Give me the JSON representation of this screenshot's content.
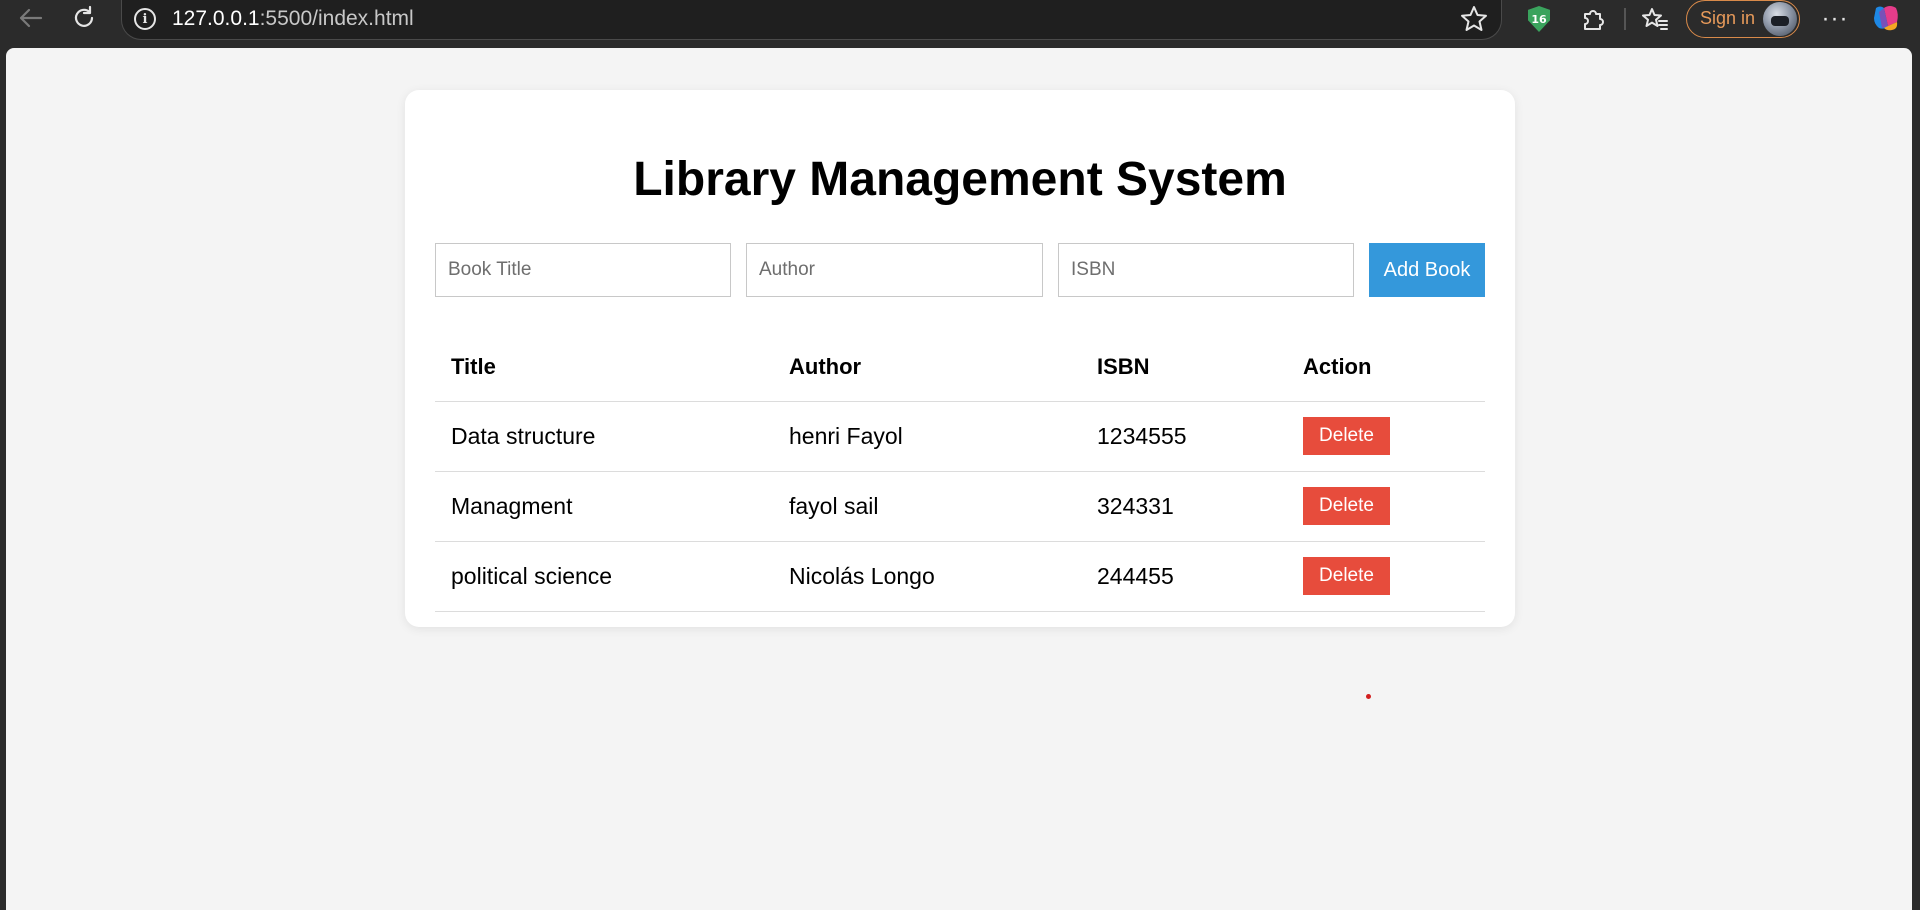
{
  "browser": {
    "url_host": "127.0.0.1",
    "url_path": ":5500/index.html",
    "extension_badge": "16",
    "sign_in_label": "Sign in",
    "more_label": "···",
    "icons": [
      "back-arrow-icon",
      "refresh-icon",
      "info-icon",
      "star-icon",
      "extension-shield-icon",
      "puzzle-icon",
      "favorites-icon",
      "avatar",
      "more-icon",
      "copilot-icon"
    ]
  },
  "app": {
    "title": "Library Management System",
    "form": {
      "title_placeholder": "Book Title",
      "author_placeholder": "Author",
      "isbn_placeholder": "ISBN",
      "add_label": "Add Book"
    },
    "table": {
      "headers": [
        "Title",
        "Author",
        "ISBN",
        "Action"
      ],
      "rows": [
        {
          "title": "Data structure",
          "author": "henri Fayol",
          "isbn": "1234555",
          "action": "Delete"
        },
        {
          "title": "Managment",
          "author": "fayol sail",
          "isbn": "324331",
          "action": "Delete"
        },
        {
          "title": "political science",
          "author": "Nicolás Longo",
          "isbn": "244455",
          "action": "Delete"
        }
      ]
    }
  },
  "colors": {
    "add_button": "#3498db",
    "delete_button": "#e74c3c",
    "page_background": "#f4f4f4",
    "sign_in_accent": "#e79a5a"
  }
}
